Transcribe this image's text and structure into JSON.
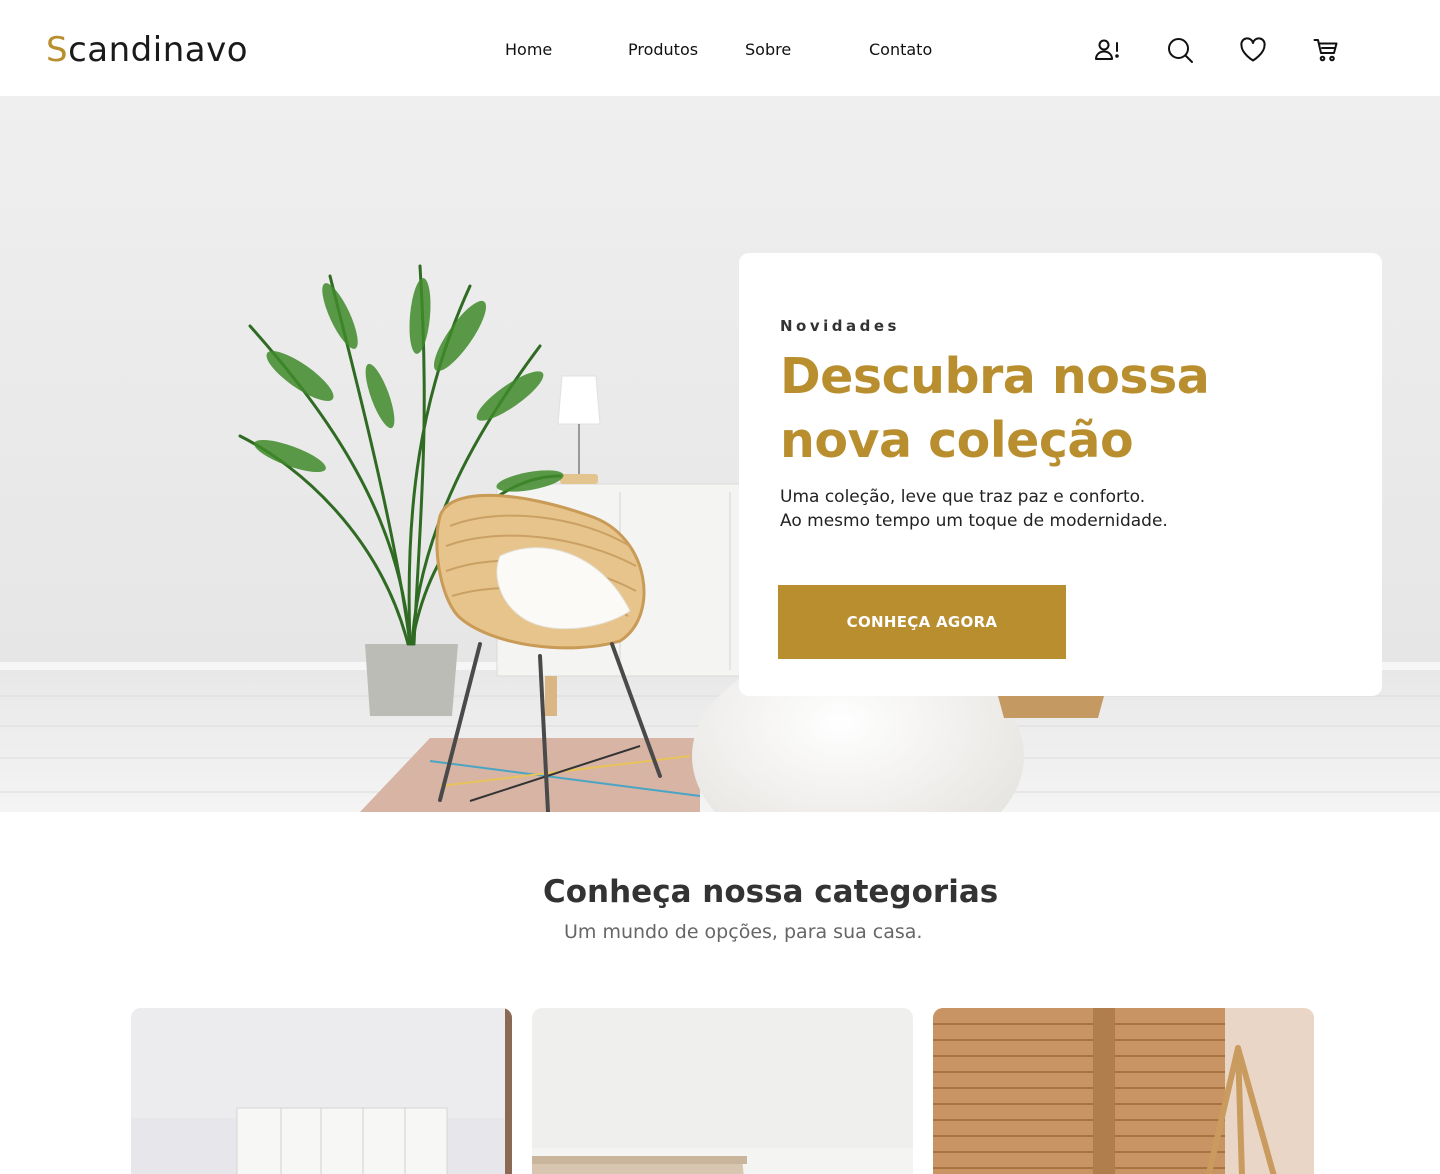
{
  "brand": {
    "first_letter": "S",
    "rest": "candinavo",
    "accent_color": "#b88e2f"
  },
  "nav": {
    "home": "Home",
    "produtos": "Produtos",
    "sobre": "Sobre",
    "contato": "Contato"
  },
  "header_icons": [
    "user-alert-icon",
    "search-icon",
    "heart-icon",
    "cart-icon"
  ],
  "hero": {
    "eyebrow": "Novidades",
    "title": "Descubra nossa nova coleção",
    "text_line1": "Uma coleção, leve que traz paz e conforto.",
    "text_line2": "Ao mesmo tempo um toque de modernidade.",
    "cta": "CONHEÇA AGORA"
  },
  "categories": {
    "title": "Conheça nossa categorias",
    "subtitle": "Um mundo de opções, para sua casa."
  },
  "colors": {
    "accent": "#b88e2f",
    "text": "#333333",
    "muted": "#666666"
  }
}
